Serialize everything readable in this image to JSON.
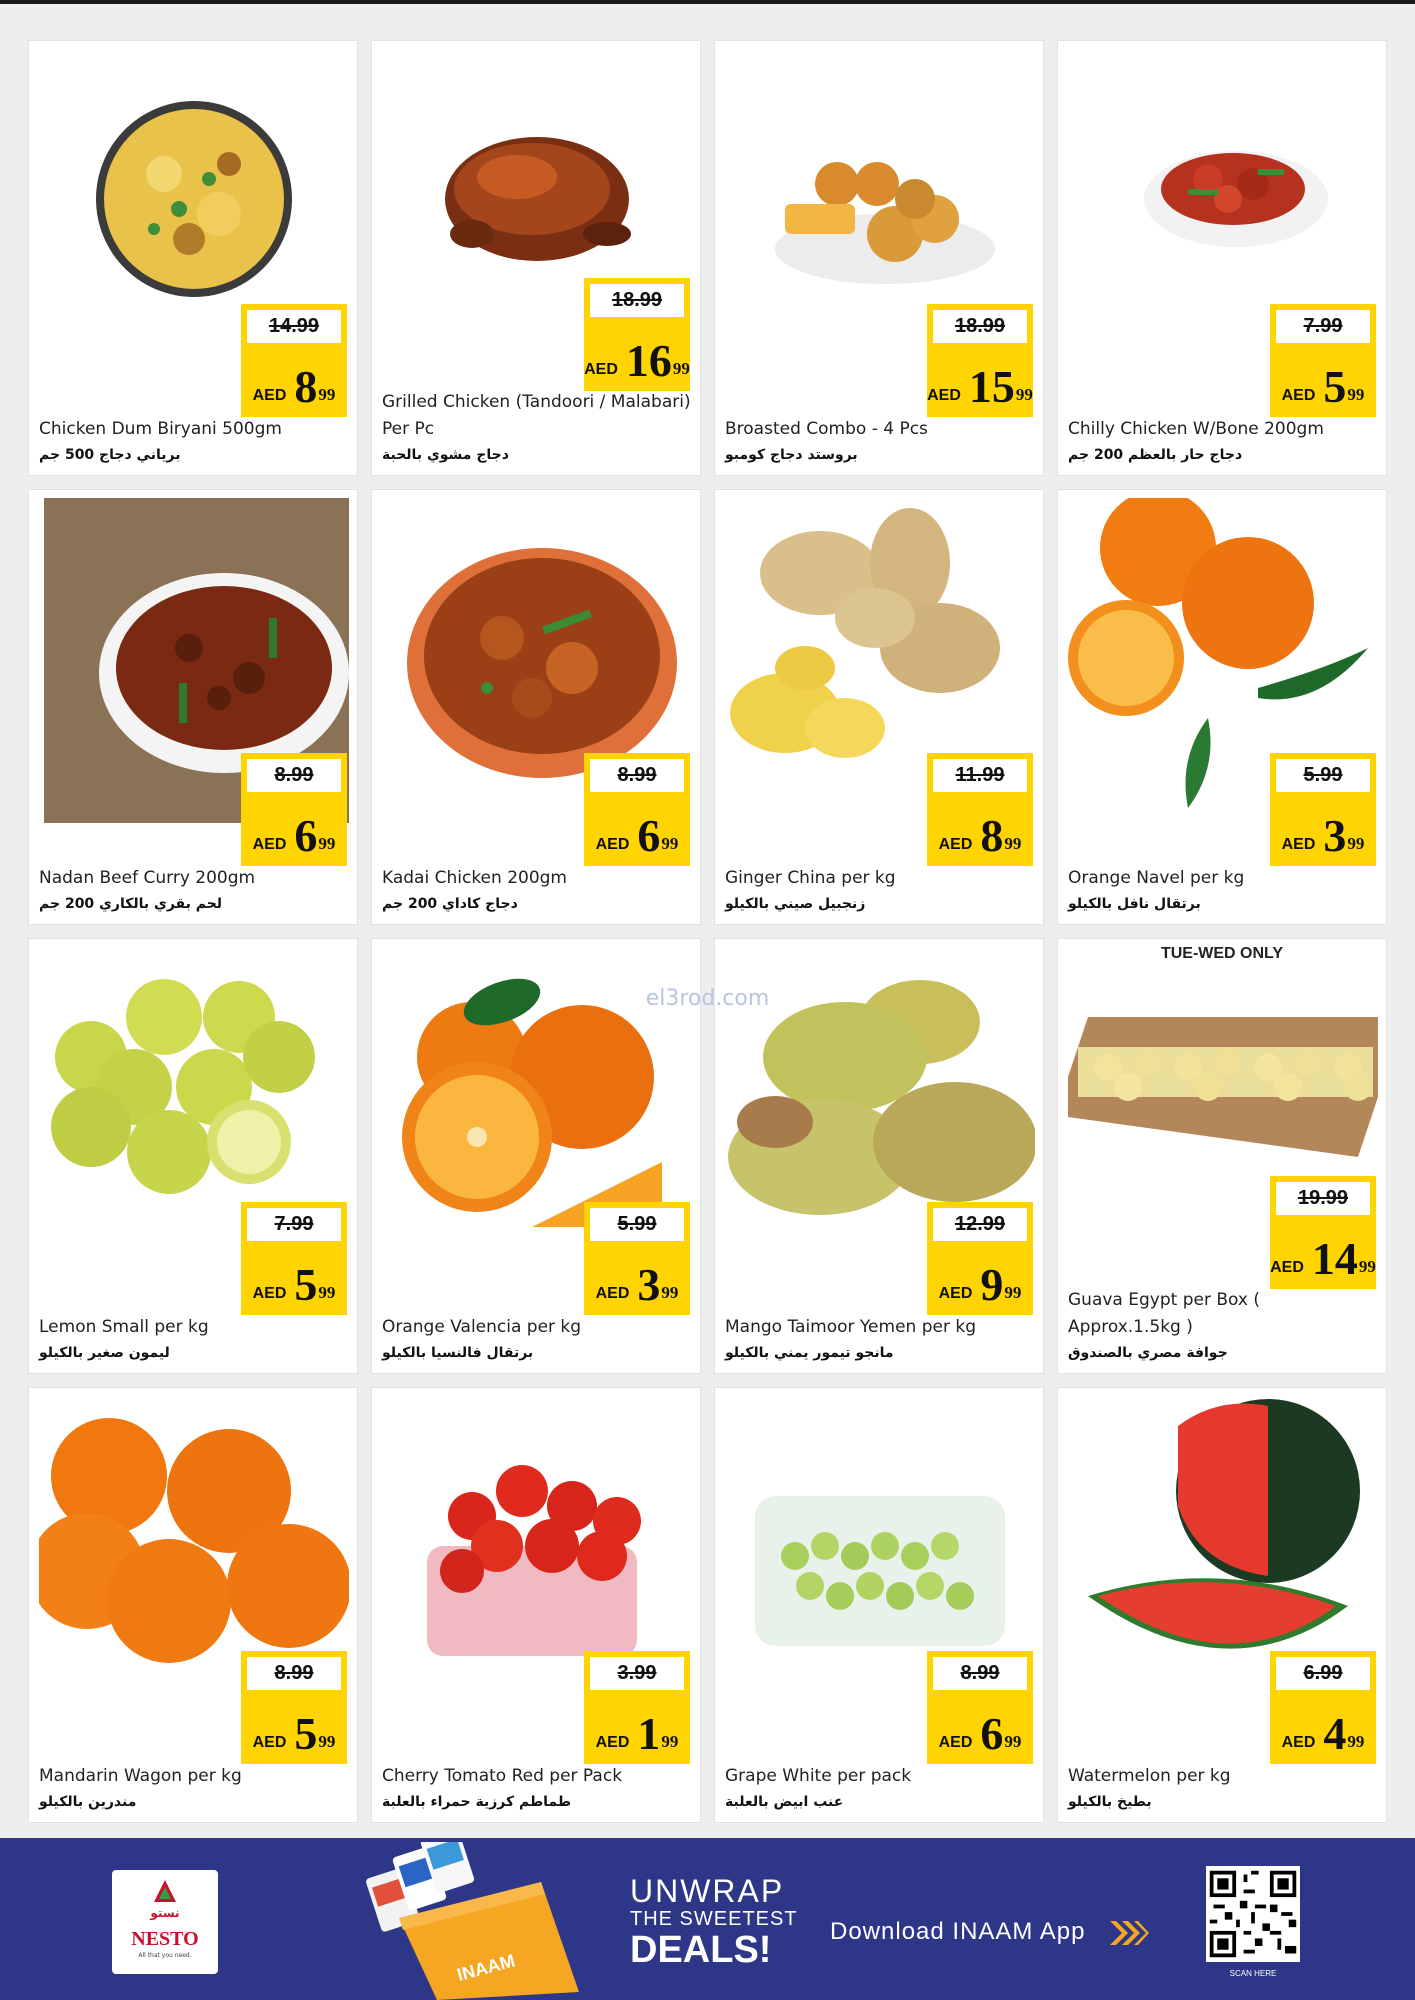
{
  "watermark": "el3rod.com",
  "currency": "AED",
  "products": [
    {
      "en": "Chicken Dum Biryani 500gm",
      "ar": "برياني دجاج 500 جم",
      "old": "14.99",
      "int": "8",
      "dec": "99",
      "icon": "biryani-plate-icon"
    },
    {
      "en": "Grilled Chicken (Tandoori / Malabari) Per Pc",
      "ar": "دجاج مشوي بالحبة",
      "old": "18.99",
      "int": "16",
      "dec": "99",
      "icon": "grilled-chicken-icon"
    },
    {
      "en": "Broasted Combo - 4 Pcs",
      "ar": "بروستد دجاج كومبو",
      "old": "18.99",
      "int": "15",
      "dec": "99",
      "icon": "broasted-combo-icon"
    },
    {
      "en": "Chilly Chicken W/Bone 200gm",
      "ar": "دجاج حار بالعظم 200 جم",
      "old": "7.99",
      "int": "5",
      "dec": "99",
      "icon": "chilly-chicken-icon"
    },
    {
      "en": "Nadan Beef Curry 200gm",
      "ar": "لحم بقري بالكاري 200 جم",
      "old": "8.99",
      "int": "6",
      "dec": "99",
      "icon": "beef-curry-icon"
    },
    {
      "en": "Kadai Chicken 200gm",
      "ar": "دجاج كاداي 200 جم",
      "old": "8.99",
      "int": "6",
      "dec": "99",
      "icon": "kadai-chicken-icon"
    },
    {
      "en": "Ginger China per kg",
      "ar": "زنجبيل صيني بالكيلو",
      "old": "11.99",
      "int": "8",
      "dec": "99",
      "icon": "ginger-icon"
    },
    {
      "en": "Orange Navel per kg",
      "ar": "برتقال نافل بالكيلو",
      "old": "5.99",
      "int": "3",
      "dec": "99",
      "icon": "orange-navel-icon"
    },
    {
      "en": "Lemon Small per kg",
      "ar": "ليمون صغير بالكيلو",
      "old": "7.99",
      "int": "5",
      "dec": "99",
      "icon": "lemon-icon"
    },
    {
      "en": "Orange Valencia per kg",
      "ar": "برتقال فالنسيا بالكيلو",
      "old": "5.99",
      "int": "3",
      "dec": "99",
      "icon": "orange-valencia-icon"
    },
    {
      "en": "Mango Taimoor Yemen per kg",
      "ar": "مانجو تيمور يمني بالكيلو",
      "old": "12.99",
      "int": "9",
      "dec": "99",
      "icon": "mango-icon"
    },
    {
      "en": "Guava Egypt per Box ( Approx.1.5kg )",
      "ar": "جوافة مصري بالصندوق",
      "old": "19.99",
      "int": "14",
      "dec": "99",
      "icon": "guava-box-icon",
      "note": "TUE-WED ONLY"
    },
    {
      "en": "Mandarin Wagon per kg",
      "ar": "مندرين بالكيلو",
      "old": "8.99",
      "int": "5",
      "dec": "99",
      "icon": "mandarin-icon"
    },
    {
      "en": "Cherry Tomato Red per Pack",
      "ar": "طماطم كرزية حمراء بالعلبة",
      "old": "3.99",
      "int": "1",
      "dec": "99",
      "icon": "cherry-tomato-icon"
    },
    {
      "en": "Grape White per pack",
      "ar": "عنب ابيض بالعلبة",
      "old": "8.99",
      "int": "6",
      "dec": "99",
      "icon": "grape-pack-icon"
    },
    {
      "en": "Watermelon per kg",
      "ar": "بطيخ بالكيلو",
      "old": "6.99",
      "int": "4",
      "dec": "99",
      "icon": "watermelon-icon"
    }
  ],
  "banner": {
    "logo_name": "NESTO",
    "logo_ar": "نستو",
    "logo_tagline": "All that you need.",
    "card_brand": "INAAM",
    "line1": "UNWRAP",
    "line2": "THE SWEETEST",
    "line3": "DEALS!",
    "download": "Download INAAM App",
    "scan": "SCAN HERE"
  },
  "colors": {
    "price_tag": "#ffd400",
    "banner": "#2e3787",
    "brand_red": "#c8102e",
    "accent_orange": "#f5a623"
  }
}
